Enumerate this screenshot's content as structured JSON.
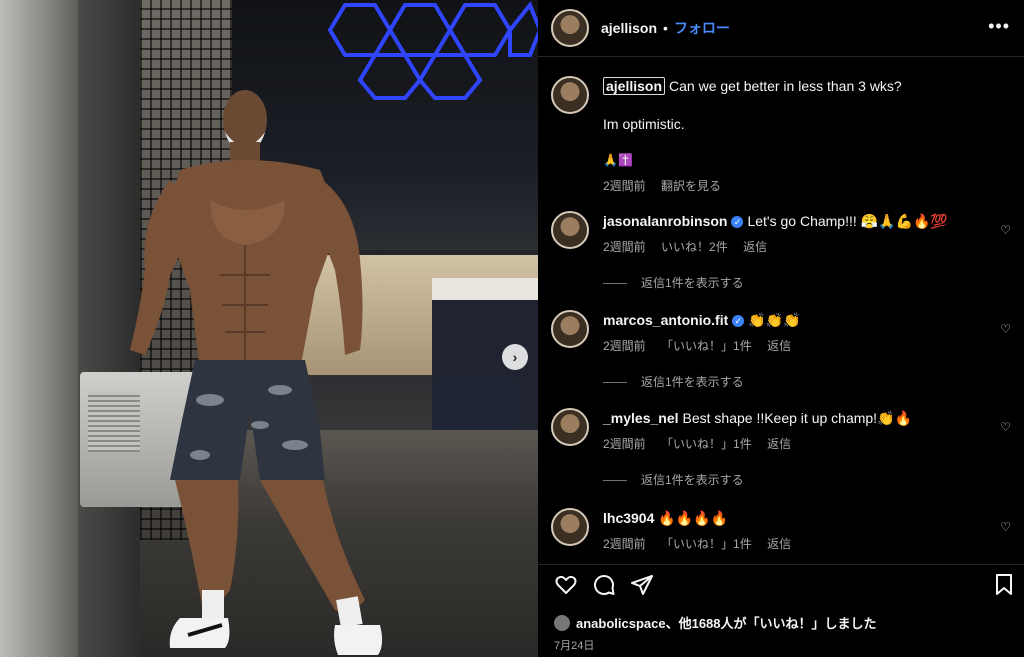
{
  "post": {
    "author": "ajellison",
    "follow_label": "フォロー",
    "dot": "•",
    "more": "•••",
    "next_icon": "›"
  },
  "caption": {
    "username": "ajellison",
    "line1": "Can we get better in less than 3 wks?",
    "line2": "Im optimistic.",
    "emoji": "🙏✝️",
    "time": "2週間前",
    "translate": "翻訳を見る"
  },
  "comments": [
    {
      "username": "jasonalanrobinson",
      "verified": true,
      "text": "Let's go Champ!!! 😤🙏💪🔥💯",
      "time": "2週間前",
      "likes": "いいね！2件",
      "reply": "返信",
      "view_replies": "返信1件を表示する"
    },
    {
      "username": "marcos_antonio.fit",
      "verified": true,
      "text": "👏👏👏",
      "time": "2週間前",
      "likes": "「いいね！」1件",
      "reply": "返信",
      "view_replies": "返信1件を表示する"
    },
    {
      "username": "_myles_nel",
      "verified": false,
      "text": "Best shape !!Keep it up champ!👏🔥",
      "time": "2週間前",
      "likes": "「いいね！」1件",
      "reply": "返信",
      "view_replies": "返信1件を表示する"
    },
    {
      "username": "lhc3904",
      "verified": false,
      "text": "🔥🔥🔥🔥",
      "time": "2週間前",
      "likes": "「いいね！」1件",
      "reply": "返信"
    }
  ],
  "footer": {
    "liked_by": "anabolicspace、他1688人が「いいね！」しました",
    "date": "7月24日"
  },
  "colors": {
    "follow": "#4a8cff",
    "verified": "#3b82f6",
    "background": "#000000",
    "hex_light": "#2f45ff"
  },
  "icons": [
    "heart-icon",
    "comment-icon",
    "share-icon",
    "save-icon",
    "more-icon",
    "verified-icon",
    "next-arrow-icon"
  ]
}
